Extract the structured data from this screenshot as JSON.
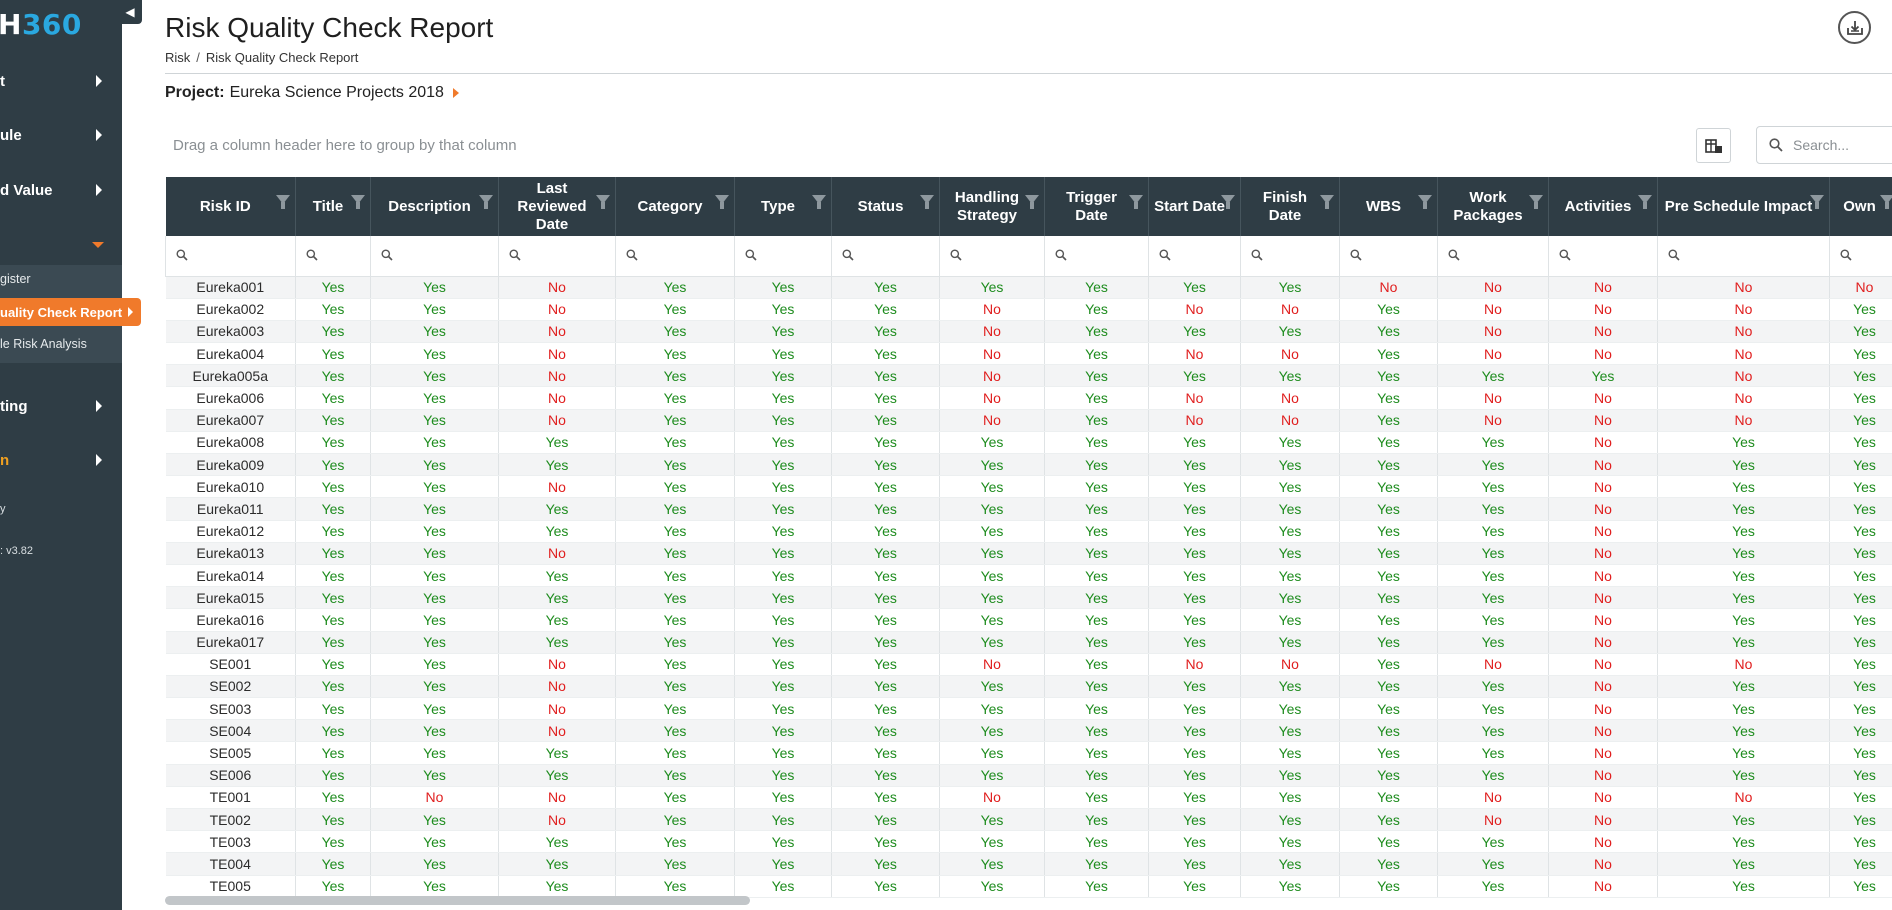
{
  "sidebar": {
    "brand_part1": "H",
    "brand_part2": "360",
    "items": [
      {
        "label": "t"
      },
      {
        "label": "ule"
      },
      {
        "label": "d Value"
      },
      {
        "label": ""
      },
      {
        "label": "ting"
      },
      {
        "label": "n"
      }
    ],
    "sub_items": [
      {
        "label": "gister"
      },
      {
        "label": "uality Check Report"
      },
      {
        "label": "le Risk Analysis"
      }
    ],
    "footer_mark": "y",
    "version": ": v3.82"
  },
  "header": {
    "title": "Risk Quality Check Report",
    "breadcrumb": [
      "Risk",
      "Risk Quality Check Report"
    ]
  },
  "project": {
    "label": "Project:",
    "name": "Eureka Science Projects 2018"
  },
  "group_panel": {
    "hint": "Drag a column header here to group by that column"
  },
  "search": {
    "placeholder": "Search..."
  },
  "colors": {
    "yes": "#1e8c1e",
    "no": "#e01e1e",
    "accent": "#f07a2b",
    "header_bg": "#2f3d45"
  },
  "grid": {
    "columns": [
      {
        "key": "id",
        "label": "Risk ID",
        "width": 130
      },
      {
        "key": "title",
        "label": "Title",
        "width": 75
      },
      {
        "key": "description",
        "label": "Description",
        "width": 128
      },
      {
        "key": "last_reviewed",
        "label": "Last Reviewed Date",
        "width": 117
      },
      {
        "key": "category",
        "label": "Category",
        "width": 119
      },
      {
        "key": "type",
        "label": "Type",
        "width": 97
      },
      {
        "key": "status",
        "label": "Status",
        "width": 108
      },
      {
        "key": "handling",
        "label": "Handling Strategy",
        "width": 105
      },
      {
        "key": "trigger",
        "label": "Trigger Date",
        "width": 104
      },
      {
        "key": "start",
        "label": "Start Date",
        "width": 92
      },
      {
        "key": "finish",
        "label": "Finish Date",
        "width": 99
      },
      {
        "key": "wbs",
        "label": "WBS",
        "width": 98
      },
      {
        "key": "work_packages",
        "label": "Work Packages",
        "width": 111
      },
      {
        "key": "activities",
        "label": "Activities",
        "width": 109
      },
      {
        "key": "pre_schedule",
        "label": "Pre Schedule Impact",
        "width": 172
      },
      {
        "key": "owner",
        "label": "Own",
        "width": 70
      }
    ],
    "rows": [
      [
        "Eureka001",
        "Yes",
        "Yes",
        "No",
        "Yes",
        "Yes",
        "Yes",
        "Yes",
        "Yes",
        "Yes",
        "Yes",
        "No",
        "No",
        "No",
        "No",
        "No"
      ],
      [
        "Eureka002",
        "Yes",
        "Yes",
        "No",
        "Yes",
        "Yes",
        "Yes",
        "No",
        "Yes",
        "No",
        "No",
        "Yes",
        "No",
        "No",
        "No",
        "Yes"
      ],
      [
        "Eureka003",
        "Yes",
        "Yes",
        "No",
        "Yes",
        "Yes",
        "Yes",
        "No",
        "Yes",
        "Yes",
        "Yes",
        "Yes",
        "No",
        "No",
        "No",
        "Yes"
      ],
      [
        "Eureka004",
        "Yes",
        "Yes",
        "No",
        "Yes",
        "Yes",
        "Yes",
        "No",
        "Yes",
        "No",
        "No",
        "Yes",
        "No",
        "No",
        "No",
        "Yes"
      ],
      [
        "Eureka005a",
        "Yes",
        "Yes",
        "No",
        "Yes",
        "Yes",
        "Yes",
        "No",
        "Yes",
        "Yes",
        "Yes",
        "Yes",
        "Yes",
        "Yes",
        "No",
        "Yes"
      ],
      [
        "Eureka006",
        "Yes",
        "Yes",
        "No",
        "Yes",
        "Yes",
        "Yes",
        "No",
        "Yes",
        "No",
        "No",
        "Yes",
        "No",
        "No",
        "No",
        "Yes"
      ],
      [
        "Eureka007",
        "Yes",
        "Yes",
        "No",
        "Yes",
        "Yes",
        "Yes",
        "No",
        "Yes",
        "No",
        "No",
        "Yes",
        "No",
        "No",
        "No",
        "Yes"
      ],
      [
        "Eureka008",
        "Yes",
        "Yes",
        "Yes",
        "Yes",
        "Yes",
        "Yes",
        "Yes",
        "Yes",
        "Yes",
        "Yes",
        "Yes",
        "Yes",
        "No",
        "Yes",
        "Yes"
      ],
      [
        "Eureka009",
        "Yes",
        "Yes",
        "Yes",
        "Yes",
        "Yes",
        "Yes",
        "Yes",
        "Yes",
        "Yes",
        "Yes",
        "Yes",
        "Yes",
        "No",
        "Yes",
        "Yes"
      ],
      [
        "Eureka010",
        "Yes",
        "Yes",
        "No",
        "Yes",
        "Yes",
        "Yes",
        "Yes",
        "Yes",
        "Yes",
        "Yes",
        "Yes",
        "Yes",
        "No",
        "Yes",
        "Yes"
      ],
      [
        "Eureka011",
        "Yes",
        "Yes",
        "Yes",
        "Yes",
        "Yes",
        "Yes",
        "Yes",
        "Yes",
        "Yes",
        "Yes",
        "Yes",
        "Yes",
        "No",
        "Yes",
        "Yes"
      ],
      [
        "Eureka012",
        "Yes",
        "Yes",
        "Yes",
        "Yes",
        "Yes",
        "Yes",
        "Yes",
        "Yes",
        "Yes",
        "Yes",
        "Yes",
        "Yes",
        "No",
        "Yes",
        "Yes"
      ],
      [
        "Eureka013",
        "Yes",
        "Yes",
        "No",
        "Yes",
        "Yes",
        "Yes",
        "Yes",
        "Yes",
        "Yes",
        "Yes",
        "Yes",
        "Yes",
        "No",
        "Yes",
        "Yes"
      ],
      [
        "Eureka014",
        "Yes",
        "Yes",
        "Yes",
        "Yes",
        "Yes",
        "Yes",
        "Yes",
        "Yes",
        "Yes",
        "Yes",
        "Yes",
        "Yes",
        "No",
        "Yes",
        "Yes"
      ],
      [
        "Eureka015",
        "Yes",
        "Yes",
        "Yes",
        "Yes",
        "Yes",
        "Yes",
        "Yes",
        "Yes",
        "Yes",
        "Yes",
        "Yes",
        "Yes",
        "No",
        "Yes",
        "Yes"
      ],
      [
        "Eureka016",
        "Yes",
        "Yes",
        "Yes",
        "Yes",
        "Yes",
        "Yes",
        "Yes",
        "Yes",
        "Yes",
        "Yes",
        "Yes",
        "Yes",
        "No",
        "Yes",
        "Yes"
      ],
      [
        "Eureka017",
        "Yes",
        "Yes",
        "Yes",
        "Yes",
        "Yes",
        "Yes",
        "Yes",
        "Yes",
        "Yes",
        "Yes",
        "Yes",
        "Yes",
        "No",
        "Yes",
        "Yes"
      ],
      [
        "SE001",
        "Yes",
        "Yes",
        "No",
        "Yes",
        "Yes",
        "Yes",
        "No",
        "Yes",
        "No",
        "No",
        "Yes",
        "No",
        "No",
        "No",
        "Yes"
      ],
      [
        "SE002",
        "Yes",
        "Yes",
        "No",
        "Yes",
        "Yes",
        "Yes",
        "Yes",
        "Yes",
        "Yes",
        "Yes",
        "Yes",
        "Yes",
        "No",
        "Yes",
        "Yes"
      ],
      [
        "SE003",
        "Yes",
        "Yes",
        "No",
        "Yes",
        "Yes",
        "Yes",
        "Yes",
        "Yes",
        "Yes",
        "Yes",
        "Yes",
        "Yes",
        "No",
        "Yes",
        "Yes"
      ],
      [
        "SE004",
        "Yes",
        "Yes",
        "No",
        "Yes",
        "Yes",
        "Yes",
        "Yes",
        "Yes",
        "Yes",
        "Yes",
        "Yes",
        "Yes",
        "No",
        "Yes",
        "Yes"
      ],
      [
        "SE005",
        "Yes",
        "Yes",
        "Yes",
        "Yes",
        "Yes",
        "Yes",
        "Yes",
        "Yes",
        "Yes",
        "Yes",
        "Yes",
        "Yes",
        "No",
        "Yes",
        "Yes"
      ],
      [
        "SE006",
        "Yes",
        "Yes",
        "Yes",
        "Yes",
        "Yes",
        "Yes",
        "Yes",
        "Yes",
        "Yes",
        "Yes",
        "Yes",
        "Yes",
        "No",
        "Yes",
        "Yes"
      ],
      [
        "TE001",
        "Yes",
        "No",
        "No",
        "Yes",
        "Yes",
        "Yes",
        "No",
        "Yes",
        "Yes",
        "Yes",
        "Yes",
        "No",
        "No",
        "No",
        "Yes"
      ],
      [
        "TE002",
        "Yes",
        "Yes",
        "No",
        "Yes",
        "Yes",
        "Yes",
        "Yes",
        "Yes",
        "Yes",
        "Yes",
        "Yes",
        "No",
        "No",
        "Yes",
        "Yes"
      ],
      [
        "TE003",
        "Yes",
        "Yes",
        "Yes",
        "Yes",
        "Yes",
        "Yes",
        "Yes",
        "Yes",
        "Yes",
        "Yes",
        "Yes",
        "Yes",
        "No",
        "Yes",
        "Yes"
      ],
      [
        "TE004",
        "Yes",
        "Yes",
        "Yes",
        "Yes",
        "Yes",
        "Yes",
        "Yes",
        "Yes",
        "Yes",
        "Yes",
        "Yes",
        "Yes",
        "No",
        "Yes",
        "Yes"
      ],
      [
        "TE005",
        "Yes",
        "Yes",
        "Yes",
        "Yes",
        "Yes",
        "Yes",
        "Yes",
        "Yes",
        "Yes",
        "Yes",
        "Yes",
        "Yes",
        "No",
        "Yes",
        "Yes"
      ]
    ]
  }
}
